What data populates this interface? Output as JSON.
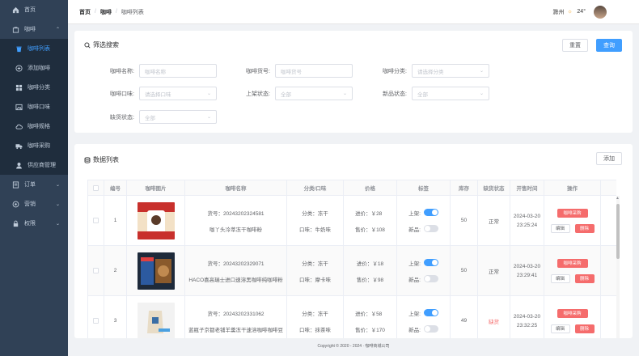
{
  "sidebar": {
    "items": [
      {
        "label": "首页",
        "icon": "home-icon"
      },
      {
        "label": "咖啡",
        "icon": "bag-icon"
      },
      {
        "label": "订单",
        "icon": "order-icon"
      },
      {
        "label": "营销",
        "icon": "marketing-icon"
      },
      {
        "label": "权限",
        "icon": "lock-icon"
      }
    ],
    "sub_items": [
      {
        "label": "咖啡列表",
        "icon": "trash-icon"
      },
      {
        "label": "添加咖啡",
        "icon": "plus-circle-icon"
      },
      {
        "label": "咖啡分类",
        "icon": "grid-icon"
      },
      {
        "label": "咖啡口味",
        "icon": "image-icon"
      },
      {
        "label": "咖啡规格",
        "icon": "cloud-icon"
      },
      {
        "label": "咖啡采购",
        "icon": "truck-icon"
      },
      {
        "label": "供应商管理",
        "icon": "user-icon"
      }
    ]
  },
  "header": {
    "breadcrumb": [
      "首页",
      "咖啡",
      "咖啡列表"
    ],
    "city": "滁州",
    "temperature": "24°"
  },
  "search": {
    "title": "筛选搜索",
    "reset_label": "重置",
    "query_label": "查询",
    "fields": [
      {
        "label": "咖啡名称:",
        "placeholder": "咖啡名称"
      },
      {
        "label": "咖啡货号:",
        "placeholder": "咖啡货号"
      },
      {
        "label": "咖啡分类:",
        "placeholder": "请选择分类"
      },
      {
        "label": "咖啡口味:",
        "placeholder": "请选择口味"
      },
      {
        "label": "上架状态:",
        "placeholder": "全部"
      },
      {
        "label": "新品状态:",
        "placeholder": "全部"
      },
      {
        "label": "缺货状态:",
        "placeholder": "全部"
      }
    ]
  },
  "data": {
    "title": "数据列表",
    "add_label": "添加",
    "columns": [
      "编号",
      "咖啡图片",
      "咖啡名称",
      "分类/口味",
      "价格",
      "标签",
      "库存",
      "缺货状态",
      "开售时间",
      "操作"
    ],
    "rows": [
      {
        "no": "1",
        "sku": "货号：20243202324581",
        "name": "咖丫头冷萃冻干咖啡粉",
        "cat": "分类：冻干",
        "taste": "口味：牛奶味",
        "cost": "进价：￥28",
        "sale": "售价：￥108",
        "on_label": "上架:",
        "new_label": "新品:",
        "on": true,
        "new": false,
        "stock": "50",
        "status": "正常",
        "out": false,
        "date": "2024-03-20",
        "time": "23:25:24"
      },
      {
        "no": "2",
        "sku": "货号：20243202329071",
        "name": "HACO喜高瑞士进口速溶黑咖啡纯咖啡粉",
        "cat": "分类：冻干",
        "taste": "口味：摩卡味",
        "cost": "进价：￥18",
        "sale": "售价：￥98",
        "on_label": "上架:",
        "new_label": "新品:",
        "on": true,
        "new": false,
        "stock": "50",
        "status": "正常",
        "out": false,
        "date": "2024-03-20",
        "time": "23:29:41"
      },
      {
        "no": "3",
        "sku": "货号：20243202331062",
        "name": "蓝瓶子京都老铺羊羹冻干速溶咖啡咖啡豆",
        "cat": "分类：冻干",
        "taste": "口味：抹茶味",
        "cost": "进价：￥58",
        "sale": "售价：￥170",
        "on_label": "上架:",
        "new_label": "新品:",
        "on": true,
        "new": false,
        "stock": "49",
        "status": "缺货",
        "out": true,
        "date": "2024-03-20",
        "time": "23:32:25"
      }
    ],
    "op_purchase": "咖啡采购",
    "op_edit": "编辑",
    "op_delete": "删除"
  },
  "footer": "Copyright © 2020 - 2024 · 咖啡商城公司",
  "colors": {
    "sidebar": "#304156",
    "primary": "#409eff",
    "danger": "#f56c6c"
  }
}
